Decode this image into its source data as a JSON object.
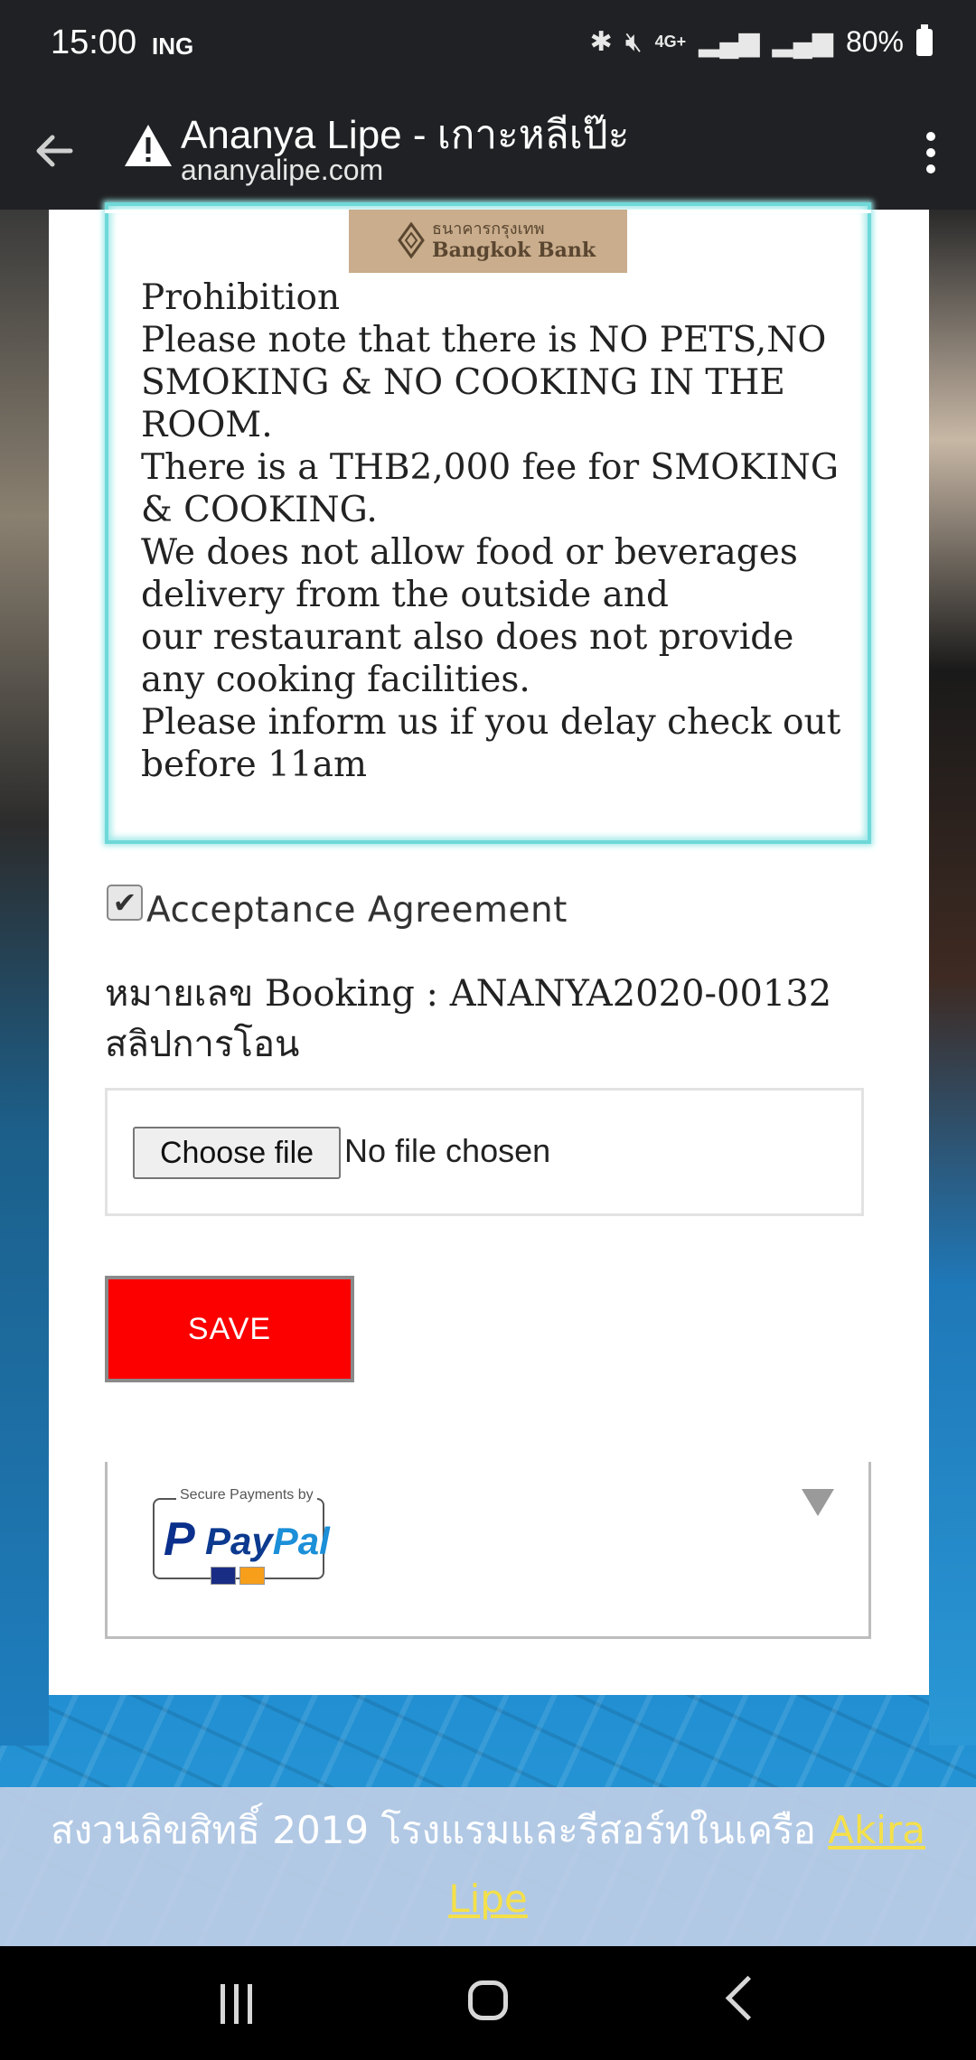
{
  "status_bar": {
    "time": "15:00",
    "carrier": "ING",
    "network": "4G+",
    "battery": "80%"
  },
  "browser": {
    "title": "Ananya Lipe - เกาะหลีเป๊ะ",
    "url": "ananyalipe.com"
  },
  "bank_logo": {
    "thai": "ธนาคารกรุงเทพ",
    "english": "Bangkok Bank"
  },
  "prohibition": {
    "lines": [
      "Prohibition",
      "Please note that there is NO PETS,NO SMOKING & NO COOKING IN THE ROOM.",
      "There is a THB2,000 fee for SMOKING & COOKING.",
      "We does not allow food or beverages delivery from the outside and",
      "our restaurant also does not provide any cooking facilities.",
      "Please inform us if you delay check out before 11am"
    ]
  },
  "acceptance": {
    "label": "Acceptance Agreement",
    "checked": true
  },
  "booking": {
    "label": "หมายเลข Booking : ANANYA2020-00132 สลิปการโอน"
  },
  "file_input": {
    "button_label": "Choose file",
    "status": "No file chosen"
  },
  "save_button": {
    "label": "SAVE"
  },
  "paypal": {
    "secure_label": "Secure Payments by",
    "brand_pay": "Pay",
    "brand_pal": "Pal",
    "p_mark": "P"
  },
  "footer": {
    "text": "สงวนลิขสิทธิ์ 2019 โรงแรมและรีสอร์ทในเครือ ",
    "link": "Akira Lipe"
  },
  "colors": {
    "save": "#fc0000",
    "info_border": "#6fd8d8",
    "footer_link": "#f4e04a"
  }
}
